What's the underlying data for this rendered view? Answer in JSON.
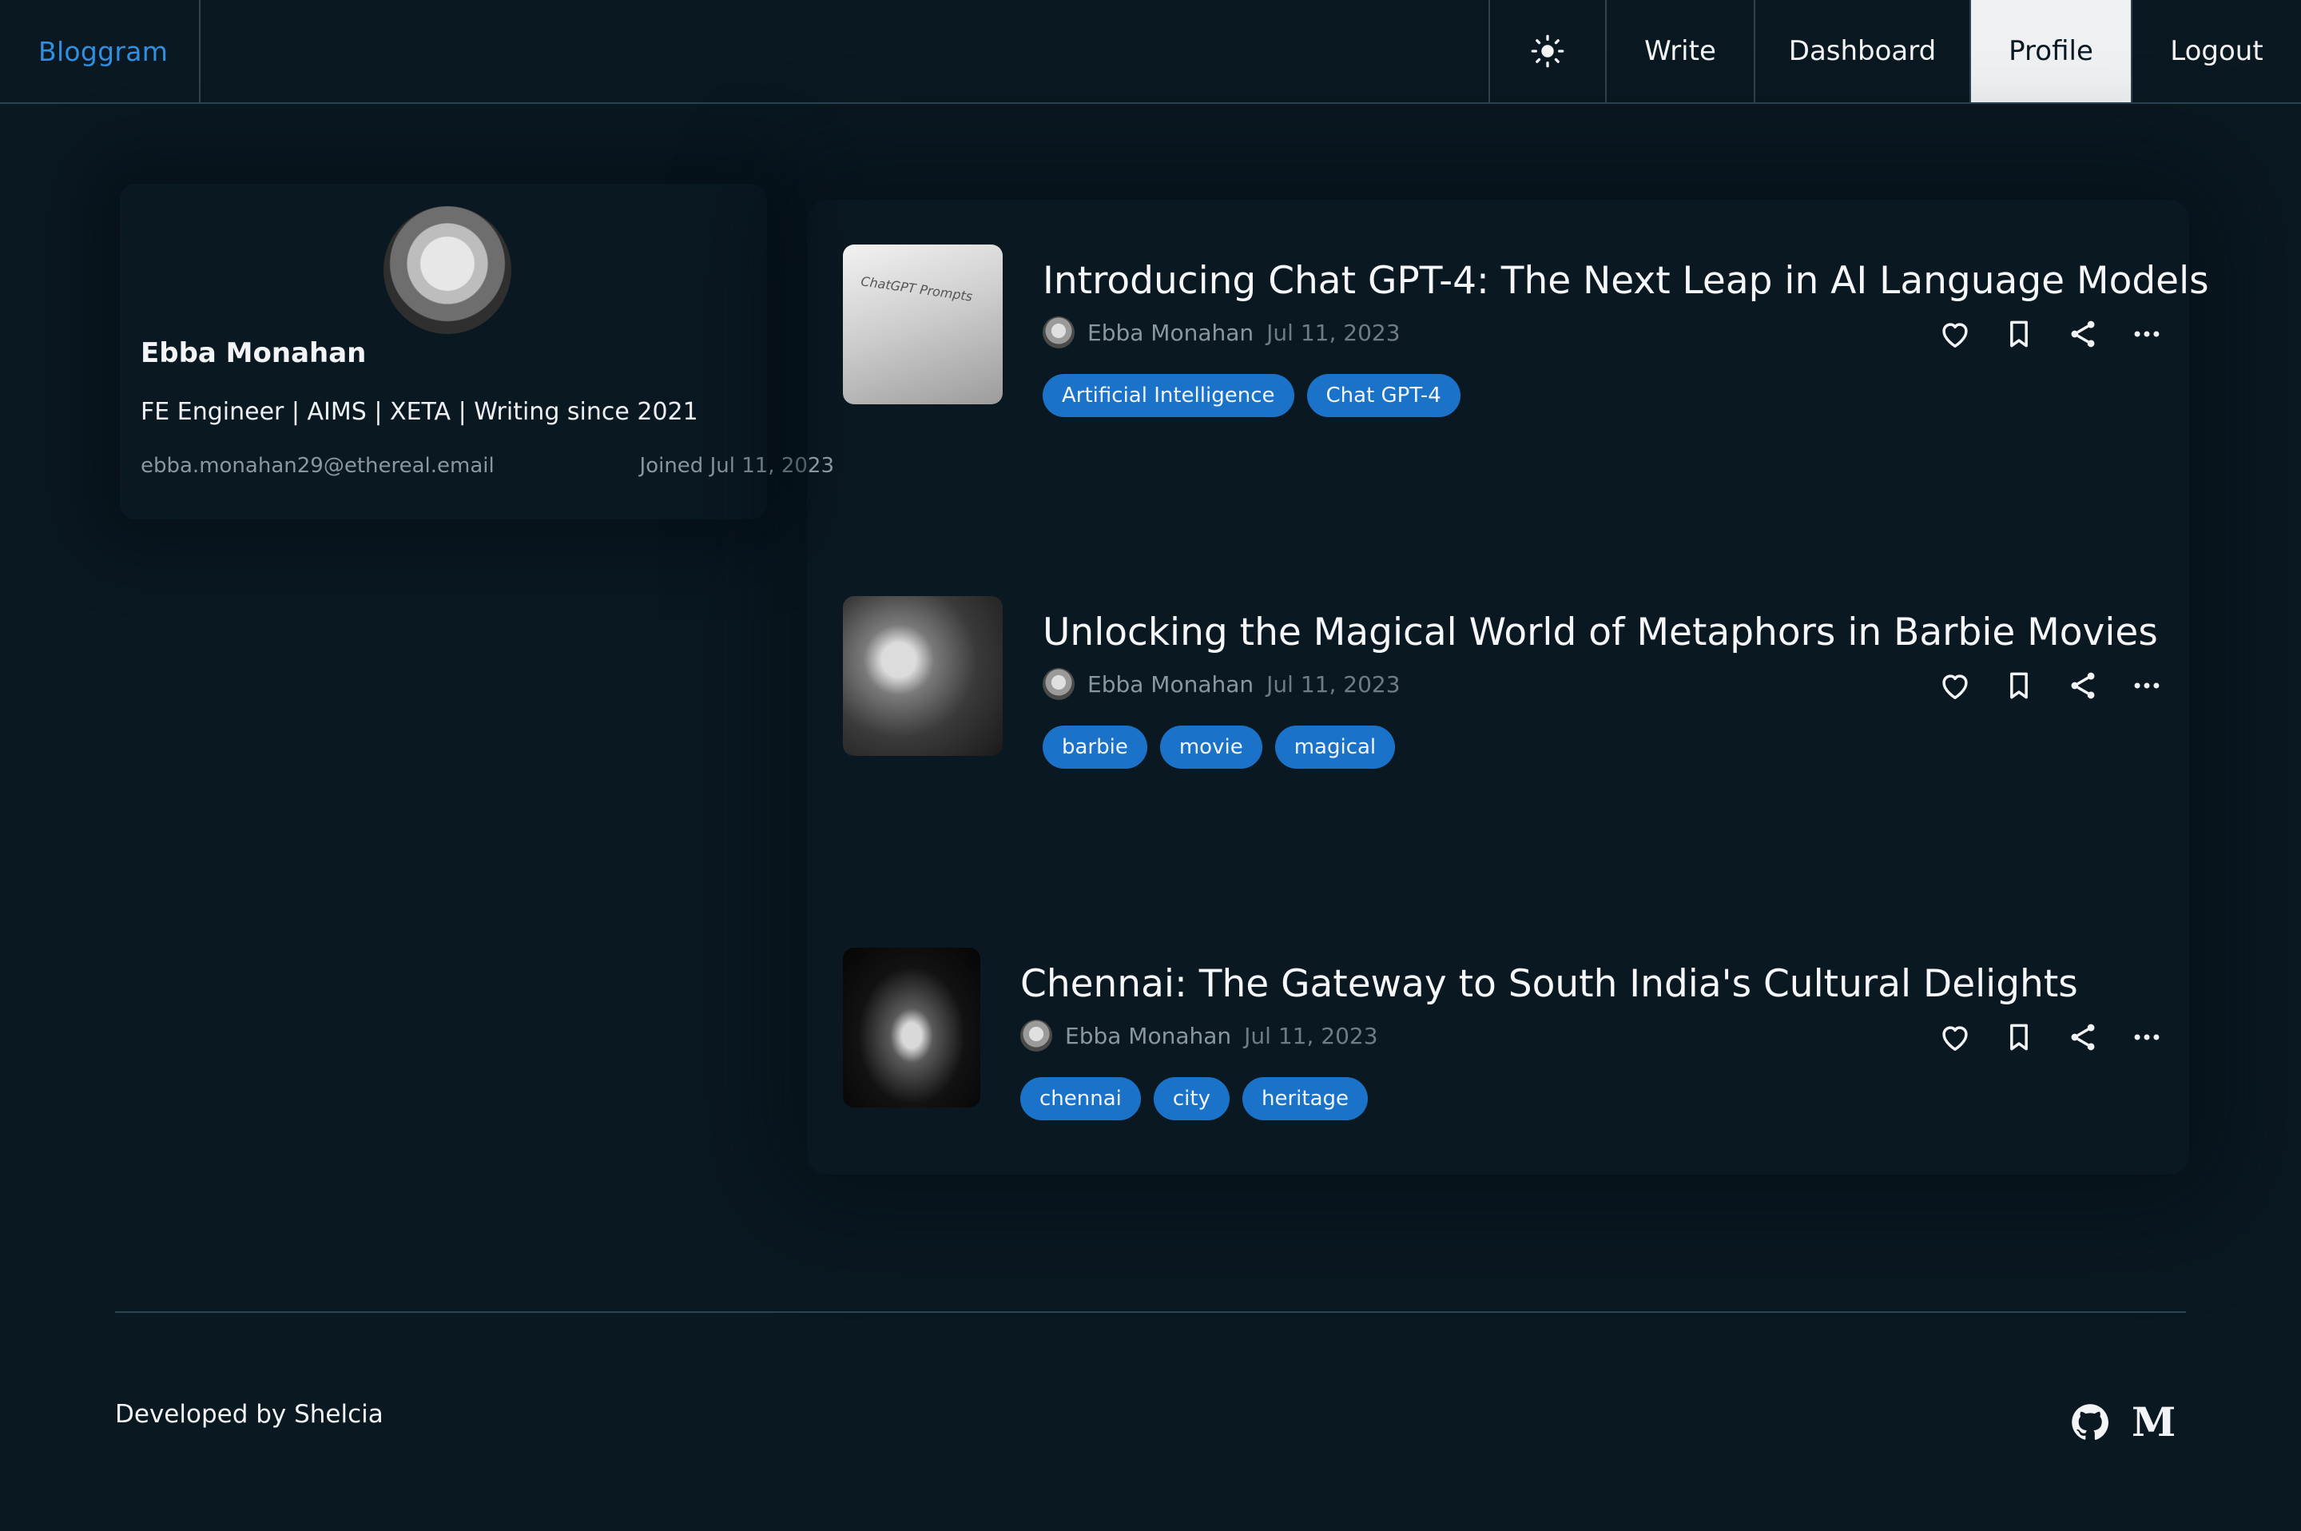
{
  "nav": {
    "brand": "Bloggram",
    "theme_icon": "sun-icon",
    "items": [
      {
        "label": "Write"
      },
      {
        "label": "Dashboard"
      },
      {
        "label": "Profile",
        "active": true
      },
      {
        "label": "Logout"
      }
    ]
  },
  "profile": {
    "name": "Ebba Monahan",
    "bio": "FE Engineer | AIMS | XETA | Writing since 2021",
    "email": "ebba.monahan29@ethereal.email",
    "joined": "Joined Jul 11, 2023"
  },
  "posts": [
    {
      "title": "Introducing Chat GPT-4: The Next Leap in AI Language Models",
      "author": "Ebba Monahan",
      "date": "Jul 11, 2023",
      "tags": [
        "Artificial Intelligence",
        "Chat GPT-4"
      ],
      "thumb_text": "ChatGPT Prompts"
    },
    {
      "title": "Unlocking the Magical World of Metaphors in Barbie Movies",
      "author": "Ebba Monahan",
      "date": "Jul 11, 2023",
      "tags": [
        "barbie",
        "movie",
        "magical"
      ]
    },
    {
      "title": "Chennai: The Gateway to South India's Cultural Delights",
      "author": "Ebba Monahan",
      "date": "Jul 11, 2023",
      "tags": [
        "chennai",
        "city",
        "heritage"
      ]
    }
  ],
  "footer": {
    "text": "Developed by Shelcia",
    "icons": [
      "github-icon",
      "medium-icon"
    ],
    "medium_glyph": "M"
  },
  "colors": {
    "background": "#0a1821",
    "brand": "#2f8fe0",
    "tag": "#1a73c9",
    "active_nav": "#eef0f2"
  }
}
